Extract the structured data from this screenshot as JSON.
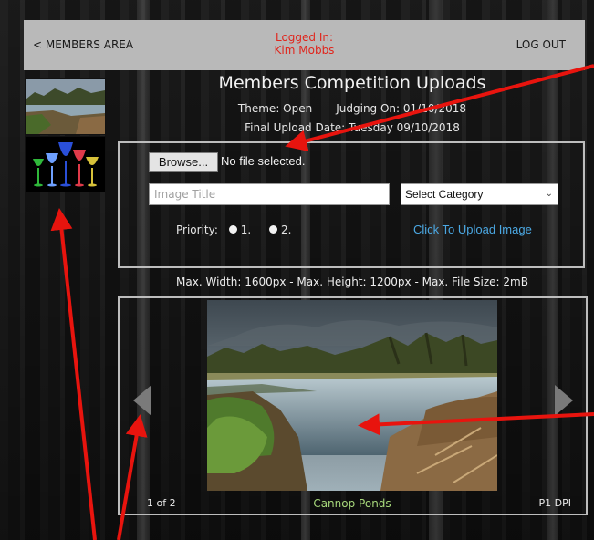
{
  "header": {
    "members_area": "< MEMBERS AREA",
    "logged_in_label": "Logged In:",
    "user_name": "Kim Mobbs",
    "logout": "LOG OUT"
  },
  "page": {
    "title": "Members Competition Uploads",
    "theme": "Theme: Open",
    "judging": "Judging On: 01/10/2018",
    "final_upload": "Final Upload Date: Tuesday 09/10/2018",
    "limits": "Max. Width: 1600px - Max. Height: 1200px - Max. File Size: 2mB"
  },
  "form": {
    "browse_label": "Browse...",
    "file_status": "No file selected.",
    "title_placeholder": "Image Title",
    "category_selected": "Select Category",
    "priority_label": "Priority:",
    "priority_options": [
      "1.",
      "2."
    ],
    "upload_link": "Click To Upload Image"
  },
  "viewer": {
    "counter": "1 of 2",
    "caption": "Cannop Ponds",
    "section": "P1 DPI"
  },
  "colors": {
    "annotation": "#e8140e",
    "link": "#4ba8e3",
    "caption": "#a7d87b",
    "logged_in": "#e0251c"
  }
}
